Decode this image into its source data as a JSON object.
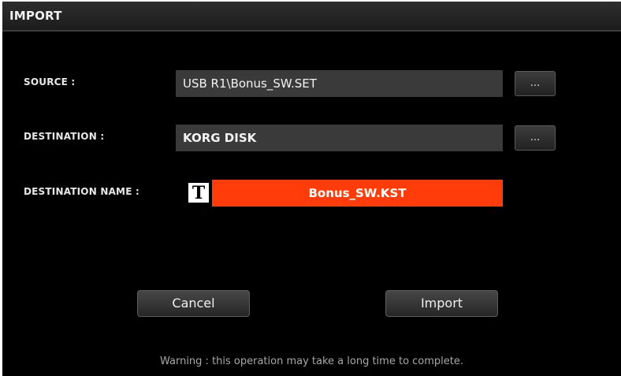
{
  "title": "IMPORT",
  "rows": {
    "source": {
      "label": "SOURCE :",
      "value": "USB R1\\Bonus_SW.SET",
      "browse_label": "..."
    },
    "destination": {
      "label": "DESTINATION :",
      "value": "KORG DISK",
      "browse_label": "..."
    },
    "destination_name": {
      "label": "DESTINATION NAME :",
      "text_icon": "T",
      "value": "Bonus_SW.KST"
    }
  },
  "buttons": {
    "cancel": "Cancel",
    "import": "Import"
  },
  "warning": "Warning : this operation may take a long time to complete.",
  "icons": {
    "text_edit": "text-edit-icon"
  },
  "colors": {
    "highlight": "#ff3c0a",
    "field_bg": "#3a3a3a",
    "background": "#000000"
  }
}
